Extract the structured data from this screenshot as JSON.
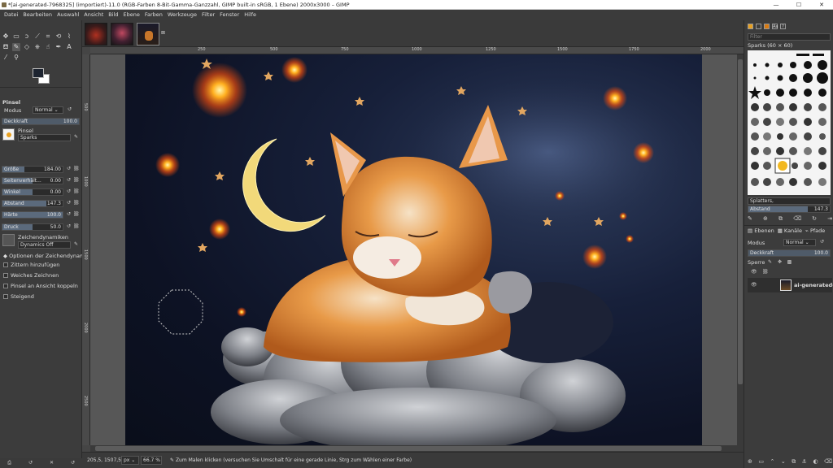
{
  "window": {
    "title": "*[ai-generated-7968325] (importiert)-11.0 (RGB-Farben 8-Bit-Gamma-Ganzzahl, GIMP built-in sRGB, 1 Ebene) 2000x3000 – GIMP",
    "minimize": "—",
    "maximize": "☐",
    "close": "✕"
  },
  "menu": [
    "Datei",
    "Bearbeiten",
    "Auswahl",
    "Ansicht",
    "Bild",
    "Ebene",
    "Farben",
    "Werkzeuge",
    "Filter",
    "Fenster",
    "Hilfe"
  ],
  "tool_options": {
    "title": "Pinsel",
    "mode_label": "Modus",
    "mode_value": "Normal ⌄",
    "opacity_label": "Deckkraft",
    "opacity_value": "100.0",
    "brush_label": "Pinsel",
    "brush_value": "Sparks",
    "sliders": [
      {
        "label": "Größe",
        "value": "184.00",
        "fraction": 0.37
      },
      {
        "label": "Seitenverhält...",
        "value": "0.00",
        "fraction": 0.5
      },
      {
        "label": "Winkel",
        "value": "0.00",
        "fraction": 0.5
      },
      {
        "label": "Abstand",
        "value": "147.3",
        "fraction": 0.73
      },
      {
        "label": "Härte",
        "value": "100.0",
        "fraction": 1.0
      },
      {
        "label": "Druck",
        "value": "50.0",
        "fraction": 0.5
      }
    ],
    "dynamics_label": "Zeichendynamiken",
    "dynamics_value": "Dynamics Off",
    "dynamics_options": "Optionen der Zeichendynam",
    "checkboxes": [
      "Zittern hinzufügen",
      "Weiches Zeichnen",
      "Pinsel an Ansicht koppeln",
      "Steigend"
    ]
  },
  "ruler": {
    "top": [
      "250",
      "500",
      "750",
      "1000",
      "1250",
      "1500",
      "1750",
      "2000"
    ],
    "left": [
      "500",
      "1000",
      "1500",
      "2000",
      "2500"
    ]
  },
  "status": {
    "coords": "205,5, 1507,5",
    "unit": "px ⌄",
    "zoom": "66.7 % ⌄",
    "message": "Zum Malen klicken (versuchen Sie Umschalt für eine gerade Linie, Strg zum Wählen einer Farbe)"
  },
  "brushes": {
    "filter_placeholder": "Filter",
    "current": "Sparks (60 × 60)",
    "tag_field": "Splatters,",
    "spacing_label": "Abstand",
    "spacing_value": "147.3"
  },
  "layers": {
    "tabs": [
      "Ebenen",
      "Kanäle",
      "Pfade"
    ],
    "mode_label": "Modus",
    "mode_value": "Normal ⌄",
    "opacity_label": "Deckkraft",
    "opacity_value": "100.0",
    "lock_label": "Sperre",
    "layer_name": "ai-generated-7"
  },
  "colors": {
    "foreground": "#1d2430",
    "background": "#ffffff"
  }
}
